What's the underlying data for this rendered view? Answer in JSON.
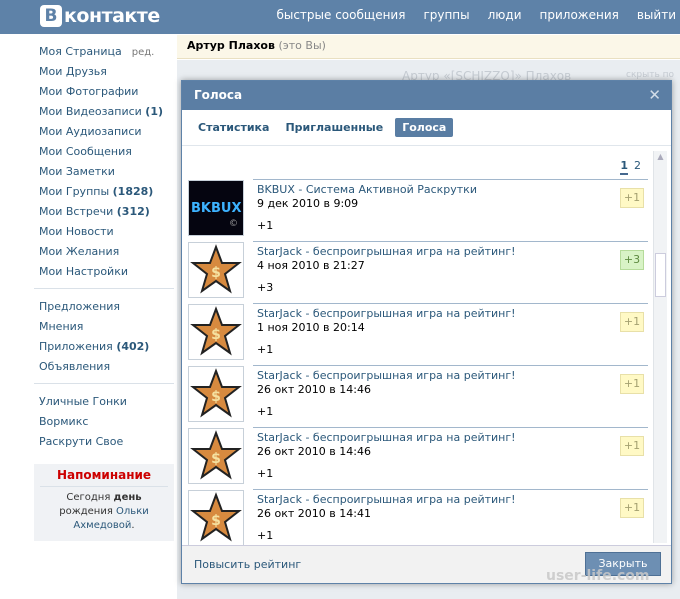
{
  "header": {
    "logo_letter": "В",
    "logo_text": "контакте",
    "nav": [
      "быстрые сообщения",
      "группы",
      "люди",
      "приложения",
      "выйти"
    ]
  },
  "sidebar": {
    "group1": [
      {
        "label": "Моя Страница",
        "count": "",
        "edit": "ред."
      },
      {
        "label": "Мои Друзья",
        "count": "",
        "edit": ""
      },
      {
        "label": "Мои Фотографии",
        "count": "",
        "edit": ""
      },
      {
        "label": "Мои Видеозаписи",
        "count": "(1)",
        "edit": ""
      },
      {
        "label": "Мои Аудиозаписи",
        "count": "",
        "edit": ""
      },
      {
        "label": "Мои Сообщения",
        "count": "",
        "edit": ""
      },
      {
        "label": "Мои Заметки",
        "count": "",
        "edit": ""
      },
      {
        "label": "Мои Группы",
        "count": "(1828)",
        "edit": ""
      },
      {
        "label": "Мои Встречи",
        "count": "(312)",
        "edit": ""
      },
      {
        "label": "Мои Новости",
        "count": "",
        "edit": ""
      },
      {
        "label": "Мои Желания",
        "count": "",
        "edit": ""
      },
      {
        "label": "Мои Настройки",
        "count": "",
        "edit": ""
      }
    ],
    "group2": [
      {
        "label": "Предложения",
        "count": ""
      },
      {
        "label": "Мнения",
        "count": ""
      },
      {
        "label": "Приложения",
        "count": "(402)"
      },
      {
        "label": "Объявления",
        "count": ""
      }
    ],
    "group3": [
      {
        "label": "Уличные Гонки"
      },
      {
        "label": "Вормикс"
      },
      {
        "label": "Раскрути Свое"
      }
    ],
    "reminder": {
      "title": "Напоминание",
      "line1": "Сегодня",
      "line1_bold": "день",
      "line2": "рождения",
      "link": "Ольки Ахмедовой",
      "dot": "."
    }
  },
  "profile": {
    "name": "Артур Плахов",
    "note": "(это Вы)",
    "bg_title": "Артур «[SCHIZZO]» Плахов",
    "bg_right": "скрыть по"
  },
  "modal": {
    "title": "Голоса",
    "tabs": [
      "Статистика",
      "Приглашенные",
      "Голоса"
    ],
    "active_tab": "Голоса",
    "pager": {
      "current": "1",
      "next": "2"
    },
    "items": [
      {
        "title": "BKBUX - Система Активной Раскрутки",
        "date": "9 дек 2010 в 9:09",
        "score": "+1",
        "vote": "+1",
        "icon": "bkbux-logo",
        "green": false
      },
      {
        "title": "StarJack - беспроигрышная игра на рейтинг!",
        "date": "4 ноя 2010 в 21:27",
        "score": "+3",
        "vote": "+3",
        "icon": "star-icon",
        "green": true
      },
      {
        "title": "StarJack - беспроигрышная игра на рейтинг!",
        "date": "1 ноя 2010 в 20:14",
        "score": "+1",
        "vote": "+1",
        "icon": "star-icon",
        "green": false
      },
      {
        "title": "StarJack - беспроигрышная игра на рейтинг!",
        "date": "26 окт 2010 в 14:46",
        "score": "+1",
        "vote": "+1",
        "icon": "star-icon",
        "green": false
      },
      {
        "title": "StarJack - беспроигрышная игра на рейтинг!",
        "date": "26 окт 2010 в 14:46",
        "score": "+1",
        "vote": "+1",
        "icon": "star-icon",
        "green": false
      },
      {
        "title": "StarJack - беспроигрышная игра на рейтинг!",
        "date": "26 окт 2010 в 14:41",
        "score": "+1",
        "vote": "+1",
        "icon": "star-icon",
        "green": false
      }
    ],
    "footer_link": "Повысить рейтинг",
    "close_button": "Закрыть"
  },
  "watermark": "user-life.com",
  "colors": {
    "brand": "#5e82a8",
    "link": "#2b587a",
    "vote_bg": "#fff9c5",
    "vote_green": "#d8f3c6"
  }
}
